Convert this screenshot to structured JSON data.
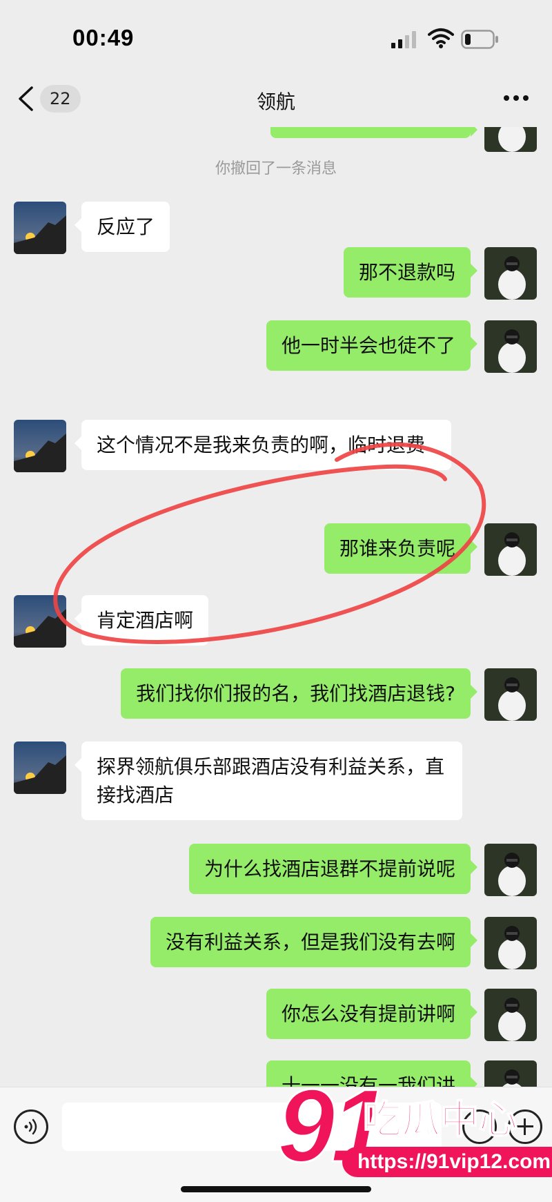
{
  "status_bar": {
    "time": "00:49"
  },
  "nav": {
    "back_count": "22",
    "title": "领航",
    "more_icon": "ellipsis-icon"
  },
  "chat": {
    "system_message": "你撤回了一条消息",
    "messages": [
      {
        "side": "in",
        "text": "反应了"
      },
      {
        "side": "out",
        "text": "那不退款吗"
      },
      {
        "side": "out",
        "text": "他一时半会也徒不了"
      },
      {
        "side": "in",
        "text": "这个情况不是我来负责的啊，临时退费"
      },
      {
        "side": "out",
        "text": "那谁来负责呢"
      },
      {
        "side": "in",
        "text": "肯定酒店啊"
      },
      {
        "side": "out",
        "text": "我们找你们报的名，我们找酒店退钱?"
      },
      {
        "side": "in",
        "text": "探界领航俱乐部跟酒店没有利益关系，直接找酒店"
      },
      {
        "side": "out",
        "text": "为什么找酒店退群不提前说呢"
      },
      {
        "side": "out",
        "text": "没有利益关系，但是我们没有去啊"
      },
      {
        "side": "out",
        "text": "你怎么没有提前讲啊"
      },
      {
        "side": "out",
        "text": "十一一没有一我们讲"
      }
    ]
  },
  "annotation": {
    "color": "#ee4444"
  },
  "input_bar": {
    "placeholder": ""
  },
  "watermark": {
    "number": "91",
    "text": "吃瓜中心",
    "url": "https://91vip12.com",
    "color": "#f0145a"
  },
  "colors": {
    "outgoing_bubble": "#95ec69",
    "incoming_bubble": "#ffffff",
    "background": "#ededed"
  }
}
